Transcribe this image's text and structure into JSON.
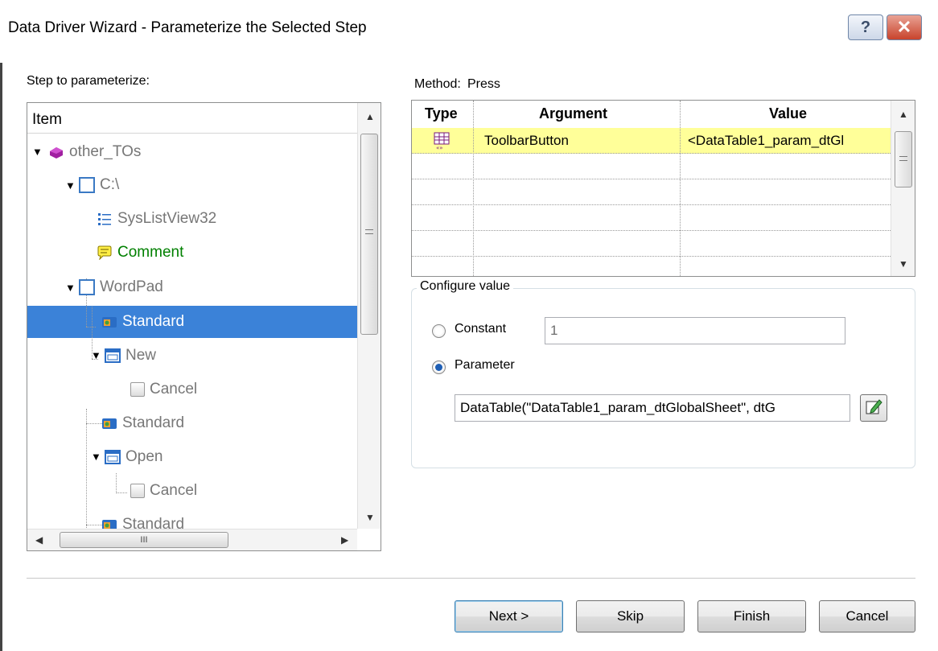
{
  "window": {
    "title": "Data Driver Wizard - Parameterize the Selected Step",
    "help_glyph": "?",
    "close_glyph": "✕"
  },
  "step_label": "Step to parameterize:",
  "tree": {
    "header": "Item",
    "nodes": [
      {
        "label": "other_TOs",
        "icon": "purple-object-icon",
        "color": "#777777"
      },
      {
        "label": "C:\\",
        "icon": "window-icon",
        "color": "#777777"
      },
      {
        "label": "SysListView32",
        "icon": "listview-icon",
        "color": "#777777"
      },
      {
        "label": "Comment",
        "icon": "comment-icon",
        "color": "#008000"
      },
      {
        "label": "WordPad",
        "icon": "window-icon",
        "color": "#777777"
      },
      {
        "label": "Standard",
        "icon": "toolbar-icon",
        "color": "#ffffff",
        "selected": true
      },
      {
        "label": "New",
        "icon": "dialog-icon",
        "color": "#777777"
      },
      {
        "label": "Cancel",
        "icon": "button-icon",
        "color": "#777777"
      },
      {
        "label": "Standard",
        "icon": "toolbar-icon",
        "color": "#777777"
      },
      {
        "label": "Open",
        "icon": "dialog-icon",
        "color": "#777777"
      },
      {
        "label": "Cancel",
        "icon": "button-icon",
        "color": "#777777"
      },
      {
        "label": "Standard",
        "icon": "toolbar-icon",
        "color": "#777777"
      }
    ],
    "hscroll_grip": "III"
  },
  "method": {
    "label": "Method:",
    "value": "Press"
  },
  "grid": {
    "headers": {
      "type": "Type",
      "argument": "Argument",
      "value": "Value"
    },
    "rows": [
      {
        "argument": "ToolbarButton",
        "value": "<DataTable1_param_dtGl",
        "icon": "datatable-icon",
        "highlight": "#ffff99"
      }
    ]
  },
  "configure": {
    "title": "Configure value",
    "constant_label": "Constant",
    "constant_value": "1",
    "parameter_label": "Parameter",
    "parameter_selected": true,
    "parameter_value": "DataTable(\"DataTable1_param_dtGlobalSheet\", dtG"
  },
  "buttons": {
    "next": "Next >",
    "skip": "Skip",
    "finish": "Finish",
    "cancel": "Cancel"
  },
  "colors": {
    "selection": "#3b82d8",
    "row_highlight": "#ffff99",
    "comment_text": "#008000"
  }
}
